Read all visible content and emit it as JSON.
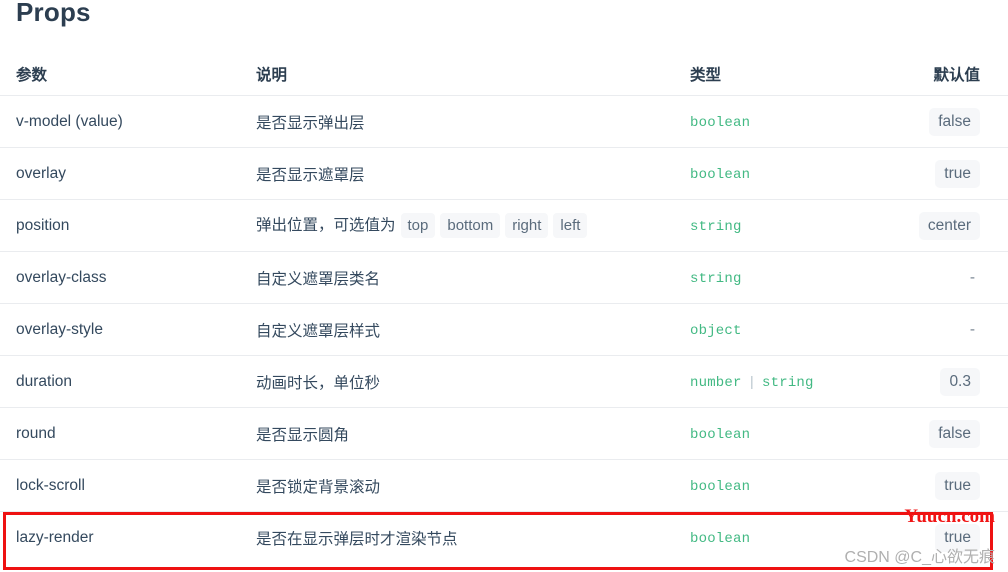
{
  "page": {
    "title": "Props"
  },
  "table": {
    "headers": {
      "param": "参数",
      "desc": "说明",
      "type": "类型",
      "default": "默认值"
    },
    "rows": [
      {
        "param": "v-model (value)",
        "desc": "是否显示弹出层",
        "desc_chips": [],
        "types": [
          "boolean"
        ],
        "default": "false",
        "default_kind": "chip"
      },
      {
        "param": "overlay",
        "desc": "是否显示遮罩层",
        "desc_chips": [],
        "types": [
          "boolean"
        ],
        "default": "true",
        "default_kind": "chip"
      },
      {
        "param": "position",
        "desc": "弹出位置，可选值为",
        "desc_chips": [
          "top",
          "bottom",
          "right",
          "left"
        ],
        "types": [
          "string"
        ],
        "default": "center",
        "default_kind": "chip"
      },
      {
        "param": "overlay-class",
        "desc": "自定义遮罩层类名",
        "desc_chips": [],
        "types": [
          "string"
        ],
        "default": "-",
        "default_kind": "dash"
      },
      {
        "param": "overlay-style",
        "desc": "自定义遮罩层样式",
        "desc_chips": [],
        "types": [
          "object"
        ],
        "default": "-",
        "default_kind": "dash"
      },
      {
        "param": "duration",
        "desc": "动画时长，单位秒",
        "desc_chips": [],
        "types": [
          "number",
          "string"
        ],
        "default": "0.3",
        "default_kind": "chip"
      },
      {
        "param": "round",
        "desc": "是否显示圆角",
        "desc_chips": [],
        "types": [
          "boolean"
        ],
        "default": "false",
        "default_kind": "chip"
      },
      {
        "param": "lock-scroll",
        "desc": "是否锁定背景滚动",
        "desc_chips": [],
        "types": [
          "boolean"
        ],
        "default": "true",
        "default_kind": "chip"
      },
      {
        "param": "lazy-render",
        "desc": "是否在显示弹层时才渲染节点",
        "desc_chips": [],
        "types": [
          "boolean"
        ],
        "default": "true",
        "default_kind": "chip"
      }
    ],
    "type_separator": "|"
  },
  "annotations": {
    "highlight_color": "#ee1111"
  },
  "watermarks": {
    "red": "Yuucn.com",
    "gray": "CSDN @C_心欲无痕"
  }
}
